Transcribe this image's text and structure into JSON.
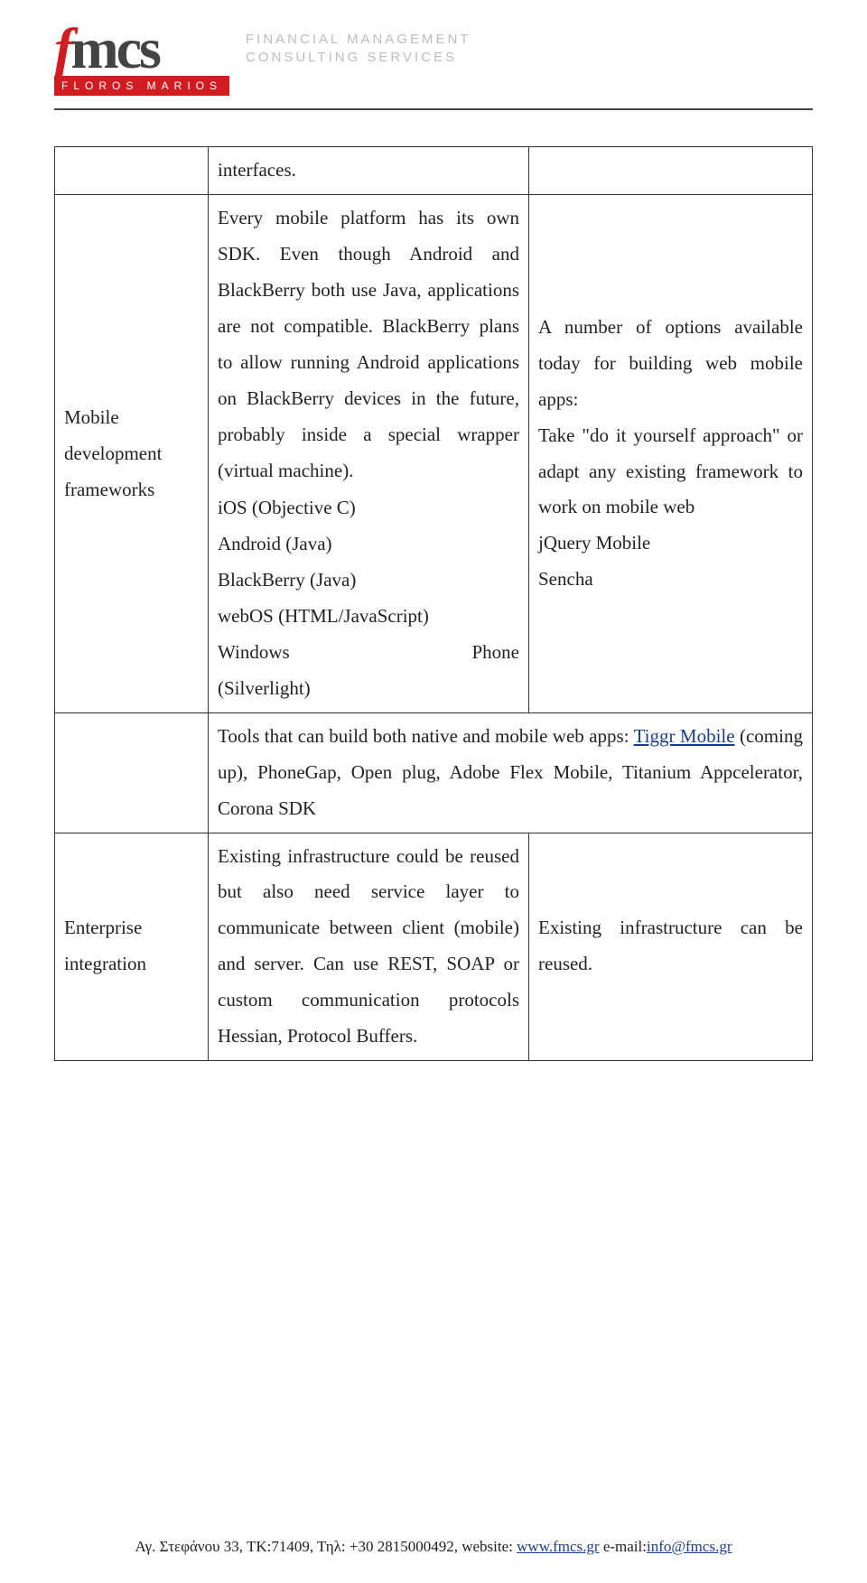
{
  "header": {
    "logo_letters": "fmcs",
    "logo_bar_text": "FLOROS MARIOS",
    "logo_sub_line1": "FINANCIAL MANAGEMENT",
    "logo_sub_line2": "CONSULTING SERVICES"
  },
  "table": {
    "row1": {
      "col2": "interfaces."
    },
    "row2": {
      "col1": "Mobile development frameworks",
      "col2_para": "Every mobile platform has its own SDK. Even though Android and BlackBerry both use Java, applications are not compatible. BlackBerry plans to allow running Android applications on BlackBerry devices in the future, probably inside a special wrapper (virtual machine).",
      "col2_platforms": [
        {
          "name": "iOS (Objective C)",
          "right": ""
        },
        {
          "name": "Android (Java)",
          "right": ""
        },
        {
          "name": "BlackBerry (Java)",
          "right": ""
        },
        {
          "name": "webOS (HTML/JavaScript)",
          "right": ""
        },
        {
          "name": "Windows",
          "right": "Phone"
        },
        {
          "name": "(Silverlight)",
          "right": ""
        }
      ],
      "col3_para": "A number of options available today for building web mobile apps:",
      "col3_line2": "Take \"do it yourself approach\" or adapt any existing framework to work on mobile web",
      "col3_line3": "jQuery Mobile",
      "col3_line4": "Sencha"
    },
    "row3": {
      "text_before_link": "Tools that can build both native and mobile web apps: ",
      "link_text": "Tiggr Mobile",
      "text_after_link": " (coming up), PhoneGap, Open plug, Adobe Flex Mobile, Titanium Appcelerator, Corona SDK"
    },
    "row4": {
      "col1": "Enterprise integration",
      "col2": "Existing infrastructure could be reused but also need service layer to communicate between client (mobile) and server. Can use REST, SOAP or custom communication protocols Hessian, Protocol Buffers.",
      "col3": "Existing infrastructure can be reused."
    }
  },
  "footer": {
    "prefix": "Αγ. Στεφάνου 33, ΤΚ:71409, Τηλ: +30 2815000492, website: ",
    "link1_text": "www.fmcs.gr",
    "mid": " e-mail:",
    "link2_text": "info@fmcs.gr"
  }
}
